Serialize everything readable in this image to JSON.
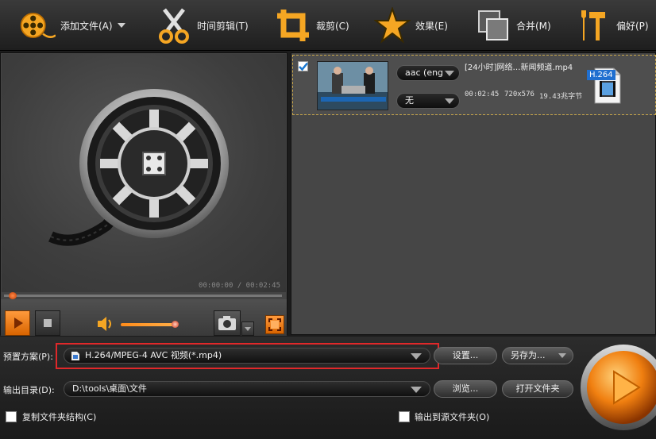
{
  "toolbar": {
    "add_file": "添加文件(A)",
    "trim": "时间剪辑(T)",
    "crop": "裁剪(C)",
    "effects": "效果(E)",
    "merge": "合并(M)",
    "preferences": "偏好(P)"
  },
  "preview": {
    "time": "00:00:00 / 00:02:45",
    "seek_progress": 0.03,
    "volume_level": 0.95,
    "icons": [
      "film-reel-icon",
      "play-icon",
      "stop-icon",
      "speaker-icon",
      "camera-icon",
      "fullscreen-icon"
    ]
  },
  "file": {
    "name": "[24小时]网络…新闻频道.mp4",
    "audio_track": "aac (eng",
    "subtitle": "无",
    "duration": "00:02:45",
    "resolution": "720x576",
    "size": "19.43兆字节",
    "format_badge": "H.264",
    "checked": true
  },
  "output": {
    "preset_label": "预置方案(P):",
    "preset_value": "H.264/MPEG-4 AVC 视频(*.mp4)",
    "settings_button": "设置...",
    "save_as_button": "另存为...",
    "dir_label": "输出目录(D):",
    "dir_value": "D:\\tools\\桌面\\文件",
    "browse_button": "浏览...",
    "open_folder_button": "打开文件夹",
    "copy_structure_label": "复制文件夹结构(C)",
    "output_to_source_label": "输出到源文件夹(O)"
  },
  "colors": {
    "accent": "#f07f10",
    "highlight_border": "#e0282a"
  }
}
